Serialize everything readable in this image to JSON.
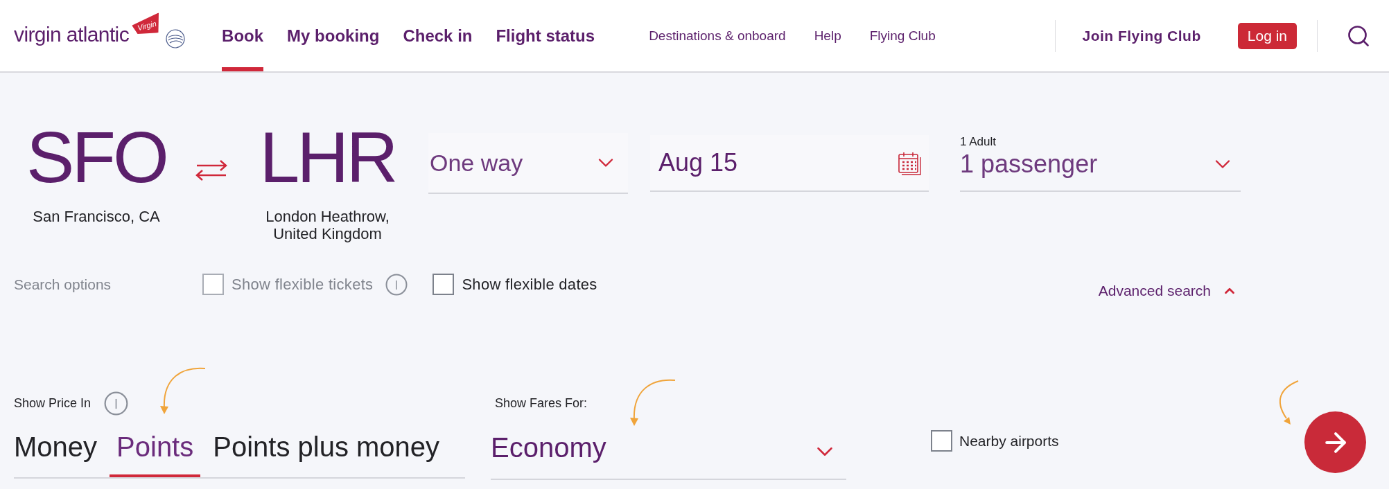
{
  "logo": {
    "wordmark": "virgin atlantic",
    "flag_text": "Virgin"
  },
  "primary_nav": [
    {
      "label": "Book",
      "selected": true
    },
    {
      "label": "My booking",
      "selected": false
    },
    {
      "label": "Check in",
      "selected": false
    },
    {
      "label": "Flight status",
      "selected": false
    }
  ],
  "secondary_nav": [
    "Destinations & onboard",
    "Help",
    "Flying Club"
  ],
  "account": {
    "join": "Join Flying Club",
    "login": "Log in"
  },
  "route": {
    "origin": {
      "code": "SFO",
      "name": "San Francisco, CA"
    },
    "destination": {
      "code": "LHR",
      "name": "London Heathrow, United Kingdom"
    }
  },
  "trip_type": {
    "value": "One way"
  },
  "date": {
    "value": "Aug 15"
  },
  "passengers": {
    "label": "1 Adult",
    "value": "1 passenger"
  },
  "search_options": {
    "label": "Search options",
    "options": [
      {
        "label": "Show flexible tickets",
        "checked": false,
        "disabled": true,
        "info": true
      },
      {
        "label": "Show flexible dates",
        "checked": false,
        "disabled": false,
        "info": false
      }
    ]
  },
  "advanced_search": {
    "label": "Advanced search",
    "expanded": true
  },
  "price": {
    "label": "Show Price In",
    "options": [
      {
        "label": "Money",
        "selected": false
      },
      {
        "label": "Points",
        "selected": true
      },
      {
        "label": "Points plus money",
        "selected": false
      }
    ]
  },
  "fares": {
    "label": "Show Fares For:",
    "value": "Economy"
  },
  "nearby_airports": {
    "label": "Nearby airports",
    "checked": false
  }
}
